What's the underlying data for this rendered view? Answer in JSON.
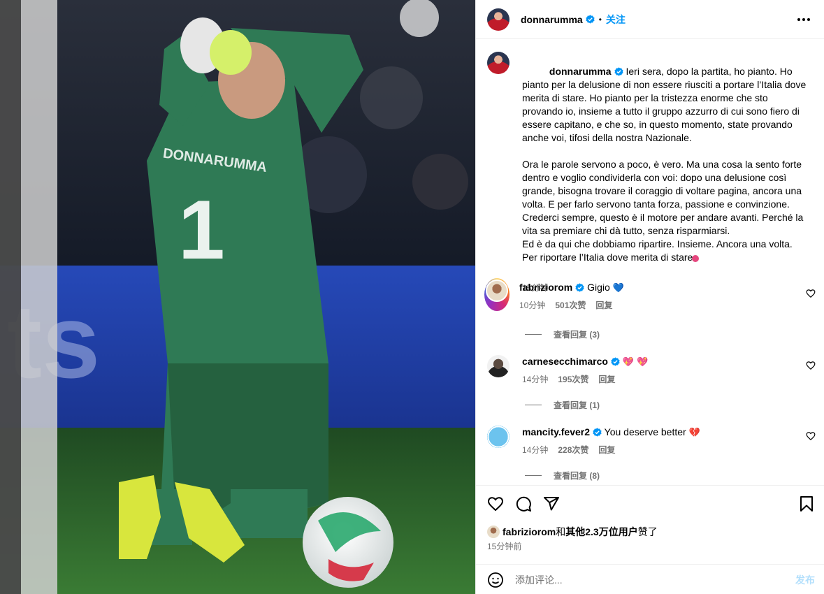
{
  "header": {
    "username": "donnarumma",
    "follow_label": "关注",
    "verified": true
  },
  "caption": {
    "username": "donnarumma",
    "text": "Ieri sera, dopo la partita, ho pianto. Ho pianto per la delusione di non essere riusciti a portare l’Italia dove merita di stare. Ho pianto per la tristezza enorme che sto provando io, insieme a tutto il gruppo azzurro di cui sono fiero di essere capitano, e che so, in questo momento, state provando anche voi, tifosi della nostra Nazionale.\n\nOra le parole servono a poco, è vero. Ma una cosa la sento forte dentro e voglio condividerla con voi: dopo una delusione così grande, bisogna trovare il coraggio di voltare pagina, ancora una volta. E per farlo servono tanta forza, passione e convinzione. Crederci sempre, questo è il motore per andare avanti. Perché la vita sa premiare chi dà tutto, senza risparmiarsi.\nEd è da qui che dobbiamo ripartire. Insieme. Ancora una volta.\nPer riportare l’Italia dove merita di stare.",
    "time": "15分钟"
  },
  "comments": [
    {
      "username": "fabriziorom",
      "text": "Gigio",
      "emoji": "💙",
      "time": "10分钟",
      "likes": "501次赞",
      "reply_label": "回复",
      "view_replies": "查看回复 (3)"
    },
    {
      "username": "carnesecchimarco",
      "text": "",
      "emoji": "💖 💖",
      "time": "14分钟",
      "likes": "195次赞",
      "reply_label": "回复",
      "view_replies": "查看回复 (1)"
    },
    {
      "username": "mancity.fever2",
      "text": "You deserve better",
      "emoji": "💔",
      "time": "14分钟",
      "likes": "228次赞",
      "reply_label": "回复",
      "view_replies": "查看回复 (8)"
    }
  ],
  "likes_line": {
    "user": "fabriziorom",
    "connector": "和",
    "others": "其他2.3万位用户",
    "suffix": "赞了"
  },
  "posted_time": "15分钟前",
  "add_comment": {
    "placeholder": "添加评论...",
    "post_label": "发布"
  },
  "photo": {
    "jersey_name": "DONNARUMMA",
    "jersey_number": "1"
  },
  "colors": {
    "accent": "#0095f6",
    "muted": "#737373",
    "jersey": "#2f7a55",
    "pitch": "#2f6b2c"
  },
  "icons": [
    "verified-badge-icon",
    "more-options-icon",
    "heart-icon",
    "comment-icon",
    "share-icon",
    "bookmark-icon",
    "emoji-icon"
  ]
}
